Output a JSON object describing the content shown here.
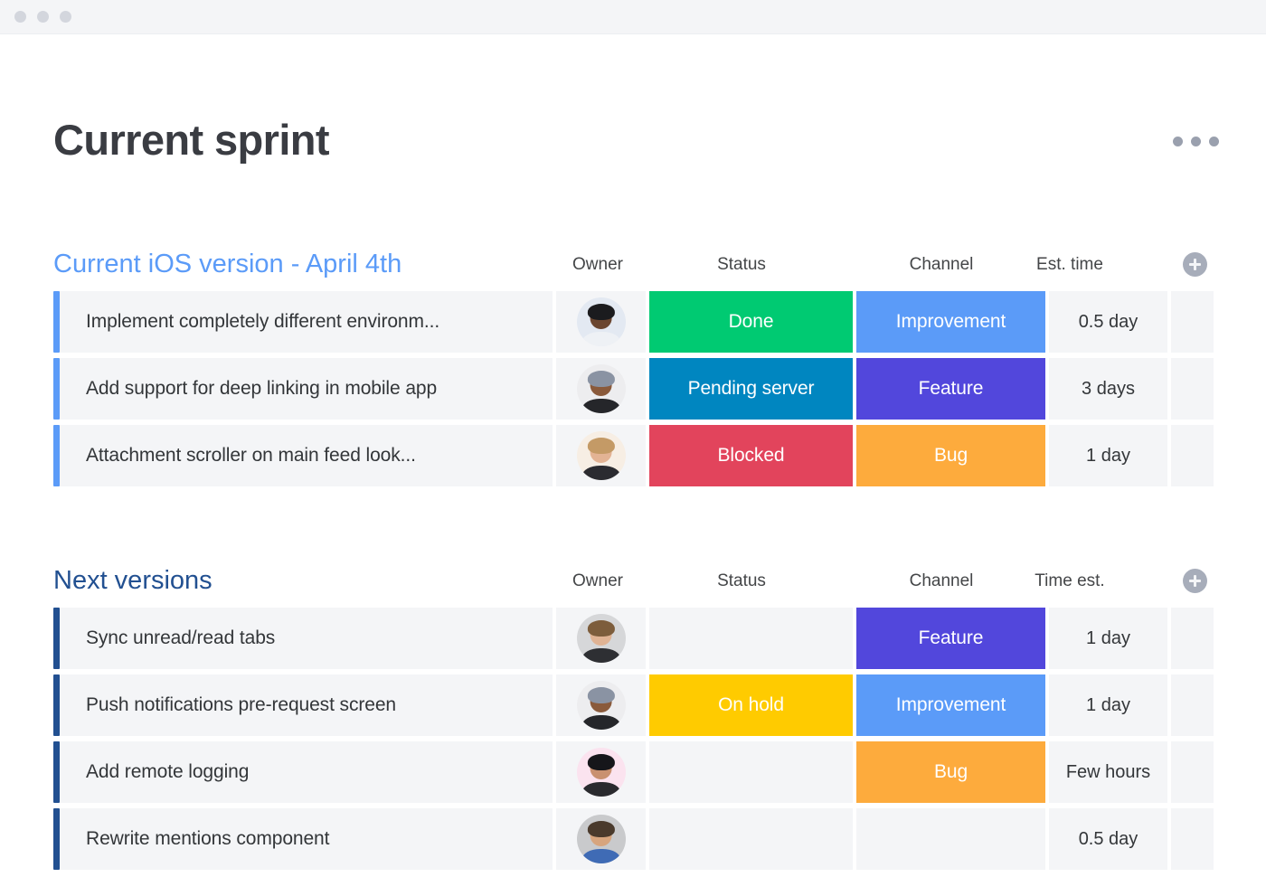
{
  "window": {
    "dots": [
      "close-dot",
      "minimize-dot",
      "maximize-dot"
    ]
  },
  "header": {
    "title": "Current sprint",
    "menu_icon": "kebab-menu-icon"
  },
  "colors": {
    "group_title_light": "#5B9BF8",
    "group_title_dark": "#225091",
    "accent_light": "#5B9BF8",
    "accent_dark": "#225091",
    "cell_bg": "#F4F5F7",
    "done_green": "#00CA72",
    "pending_blue": "#0086C0",
    "blocked_red": "#E2445C",
    "onhold_yellow": "#FFCB00",
    "improvement_blue": "#5B9BF8",
    "feature_purple": "#5247DC",
    "bug_orange": "#FDAB3D"
  },
  "groups": [
    {
      "title": "Current iOS version - April 4th",
      "title_style": "light",
      "accent_style": "light",
      "columns": [
        "Owner",
        "Status",
        "Channel",
        "Est. time"
      ],
      "add_column_label": "+",
      "rows": [
        {
          "name": "Implement completely different environm...",
          "owner": "avatar-woman-glasses",
          "status": {
            "label": "Done",
            "color": "#00CA72"
          },
          "channel": {
            "label": "Improvement",
            "color": "#5B9BF8"
          },
          "time": "0.5 day"
        },
        {
          "name": "Add support for deep linking in mobile app",
          "owner": "avatar-man-beanie",
          "status": {
            "label": "Pending server",
            "color": "#0086C0"
          },
          "channel": {
            "label": "Feature",
            "color": "#5247DC"
          },
          "time": "3 days"
        },
        {
          "name": "Attachment scroller on main feed look...",
          "owner": "avatar-woman-blonde",
          "status": {
            "label": "Blocked",
            "color": "#E2445C"
          },
          "channel": {
            "label": "Bug",
            "color": "#FDAB3D"
          },
          "time": "1 day"
        }
      ]
    },
    {
      "title": "Next versions",
      "title_style": "dark",
      "accent_style": "dark",
      "columns": [
        "Owner",
        "Status",
        "Channel",
        "Time est."
      ],
      "add_column_label": "+",
      "rows": [
        {
          "name": "Sync unread/read tabs",
          "owner": "avatar-man-short-hair",
          "status": {
            "label": "",
            "color": ""
          },
          "channel": {
            "label": "Feature",
            "color": "#5247DC"
          },
          "time": "1 day"
        },
        {
          "name": "Push notifications pre-request screen",
          "owner": "avatar-man-beanie",
          "status": {
            "label": "On hold",
            "color": "#FFCB00"
          },
          "channel": {
            "label": "Improvement",
            "color": "#5B9BF8"
          },
          "time": "1 day"
        },
        {
          "name": "Add remote logging",
          "owner": "avatar-woman-dark-hair",
          "status": {
            "label": "",
            "color": ""
          },
          "channel": {
            "label": "Bug",
            "color": "#FDAB3D"
          },
          "time": "Few hours"
        },
        {
          "name": "Rewrite mentions component",
          "owner": "avatar-man-long-hair",
          "status": {
            "label": "",
            "color": ""
          },
          "channel": {
            "label": "",
            "color": ""
          },
          "time": "0.5 day"
        }
      ]
    }
  ]
}
